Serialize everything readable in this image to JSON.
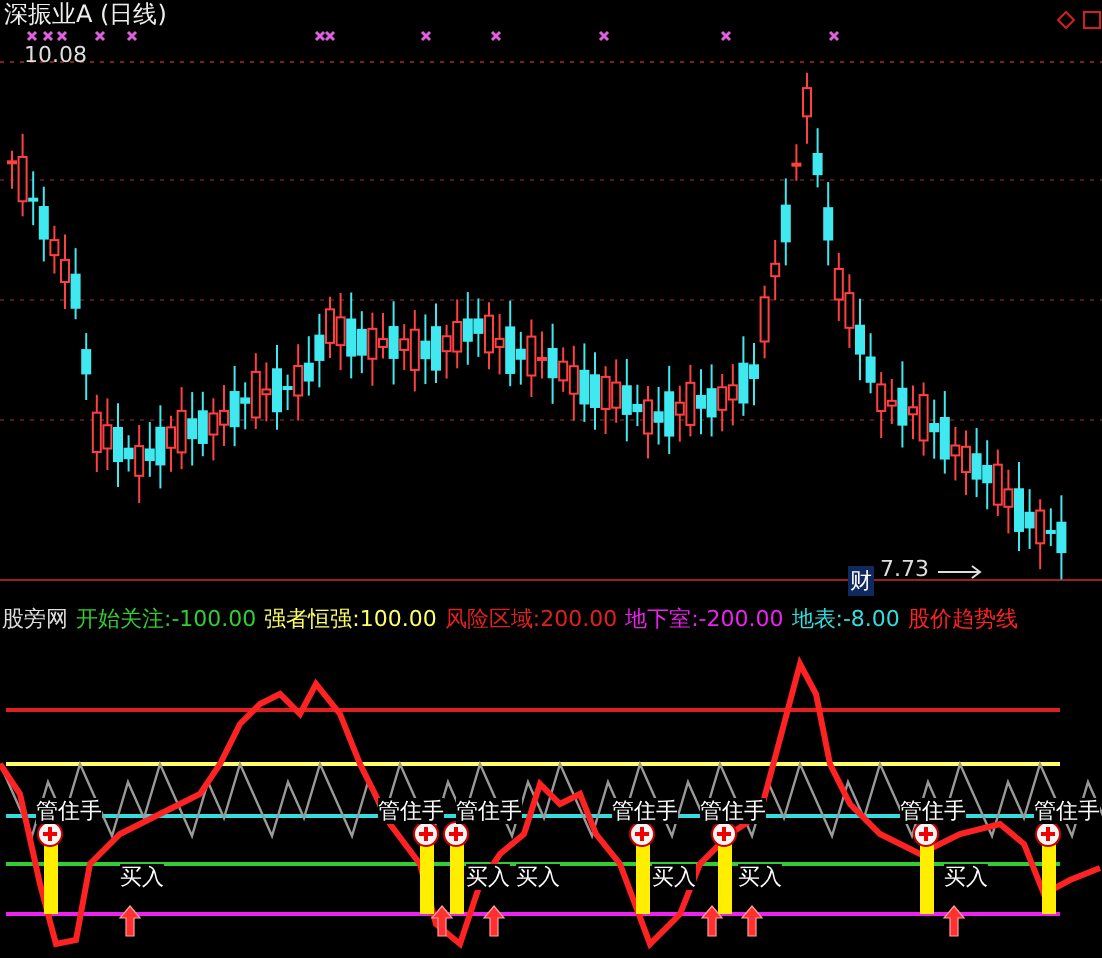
{
  "main_chart": {
    "title": "深振业A (日线)",
    "high_label": "10.08",
    "low_label": "7.73",
    "finance_badge": "财"
  },
  "indicator": {
    "name": "股旁网",
    "legend": [
      {
        "label": "开始关注:-100.00",
        "color": "#33cc33"
      },
      {
        "label": "强者恒强:100.00",
        "color": "#ffff66"
      },
      {
        "label": "风险区域:200.00",
        "color": "#e02020"
      },
      {
        "label": "地下室:-200.00",
        "color": "#ee22ee"
      },
      {
        "label": "地表:-8.00",
        "color": "#33dddd"
      },
      {
        "label": "股价趋势线",
        "color": "#ff2222"
      }
    ],
    "hold_signals": [
      {
        "label": "管住手"
      },
      {
        "label": "管住手"
      },
      {
        "label": "管住手"
      },
      {
        "label": "管住手"
      },
      {
        "label": "管住手"
      },
      {
        "label": "管住手"
      },
      {
        "label": "管住手"
      }
    ],
    "buy_signals": [
      {
        "label": "买入"
      },
      {
        "label": "买入"
      },
      {
        "label": "买入"
      },
      {
        "label": "买入"
      },
      {
        "label": "买入"
      },
      {
        "label": "买入"
      }
    ]
  }
}
